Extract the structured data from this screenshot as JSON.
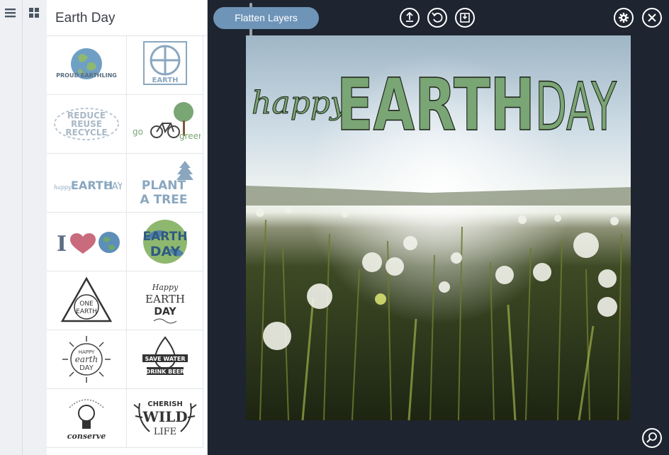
{
  "sidebar": {
    "title": "Earth Day",
    "tiles": [
      {
        "name": "sticker-proud-earthling",
        "label": "PROUD EARTHLING"
      },
      {
        "name": "sticker-earth-symbol",
        "label": "EARTH"
      },
      {
        "name": "sticker-reduce-reuse-recycle",
        "lines": [
          "REDUCE",
          "REUSE",
          "RECYCLE"
        ]
      },
      {
        "name": "sticker-go-green",
        "label_a": "go",
        "label_b": "green"
      },
      {
        "name": "sticker-happy-earth-day",
        "label_a": "happy",
        "label_b": "EARTH",
        "label_c": "DAY"
      },
      {
        "name": "sticker-plant-a-tree",
        "line1": "PLANT",
        "line2": "A TREE"
      },
      {
        "name": "sticker-i-love-earth",
        "label": "I"
      },
      {
        "name": "sticker-earth-day-globe",
        "line1": "EARTH",
        "line2": "DAY"
      },
      {
        "name": "sticker-one-earth",
        "line1": "ONE",
        "line2": "EARTH"
      },
      {
        "name": "sticker-happy-earth-day-script",
        "line1": "Happy",
        "line2": "EARTH",
        "line3": "DAY"
      },
      {
        "name": "sticker-happy-earth-day-badge",
        "line1": "HAPPY",
        "line2": "earth",
        "line3": "DAY"
      },
      {
        "name": "sticker-save-water",
        "line1": "SAVE WATER",
        "line2": "DRINK BEER"
      },
      {
        "name": "sticker-conserve",
        "label": "conserve"
      },
      {
        "name": "sticker-cherish-wild-life",
        "line1": "CHERISH",
        "line2": "WILD",
        "line3": "LIFE"
      }
    ]
  },
  "toolbar": {
    "flatten_label": "Flatten Layers",
    "icons": [
      "upload-icon",
      "undo-icon",
      "save-icon",
      "settings-icon",
      "close-icon",
      "zoom-icon"
    ]
  },
  "canvas": {
    "overlay_happy": "happy",
    "overlay_earth": "EARTH",
    "overlay_day": "DAY"
  },
  "colors": {
    "accent": "#6e94b8",
    "workspace": "#1e2430",
    "earth_green": "#7aa575",
    "sticker_blue": "#8aa7bf"
  }
}
